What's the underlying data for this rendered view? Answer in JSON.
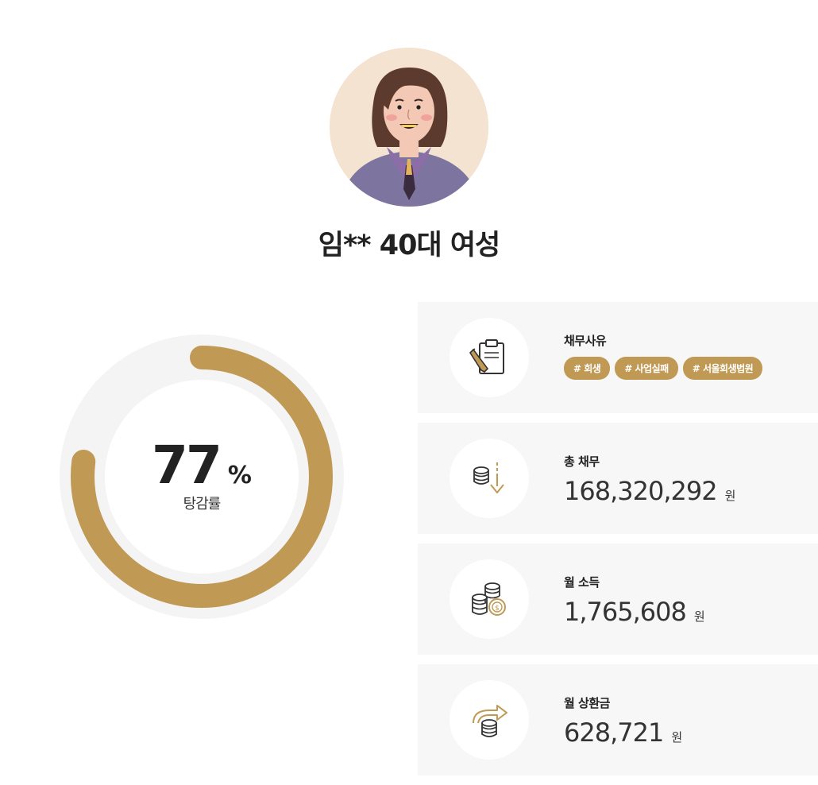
{
  "profile": {
    "name": "임** 40대 여성"
  },
  "reduction": {
    "value": "77",
    "unit": "%",
    "label": "탕감률",
    "fraction": 0.77,
    "accent_color": "#c09a55",
    "track_color": "#f4f4f4"
  },
  "cards": {
    "reason": {
      "title": "채무사유",
      "icon": "clipboard-pencil-icon",
      "tags": [
        "# 회생",
        "# 사업실패",
        "# 서울회생법원"
      ]
    },
    "total_debt": {
      "title": "총 채무",
      "icon": "coins-down-arrow-icon",
      "value": "168,320,292",
      "unit": "원"
    },
    "monthly_income": {
      "title": "월 소득",
      "icon": "coin-stacks-icon",
      "value": "1,765,608",
      "unit": "원"
    },
    "monthly_repayment": {
      "title": "월 상환금",
      "icon": "coins-arrow-icon",
      "value": "628,721",
      "unit": "원"
    }
  }
}
